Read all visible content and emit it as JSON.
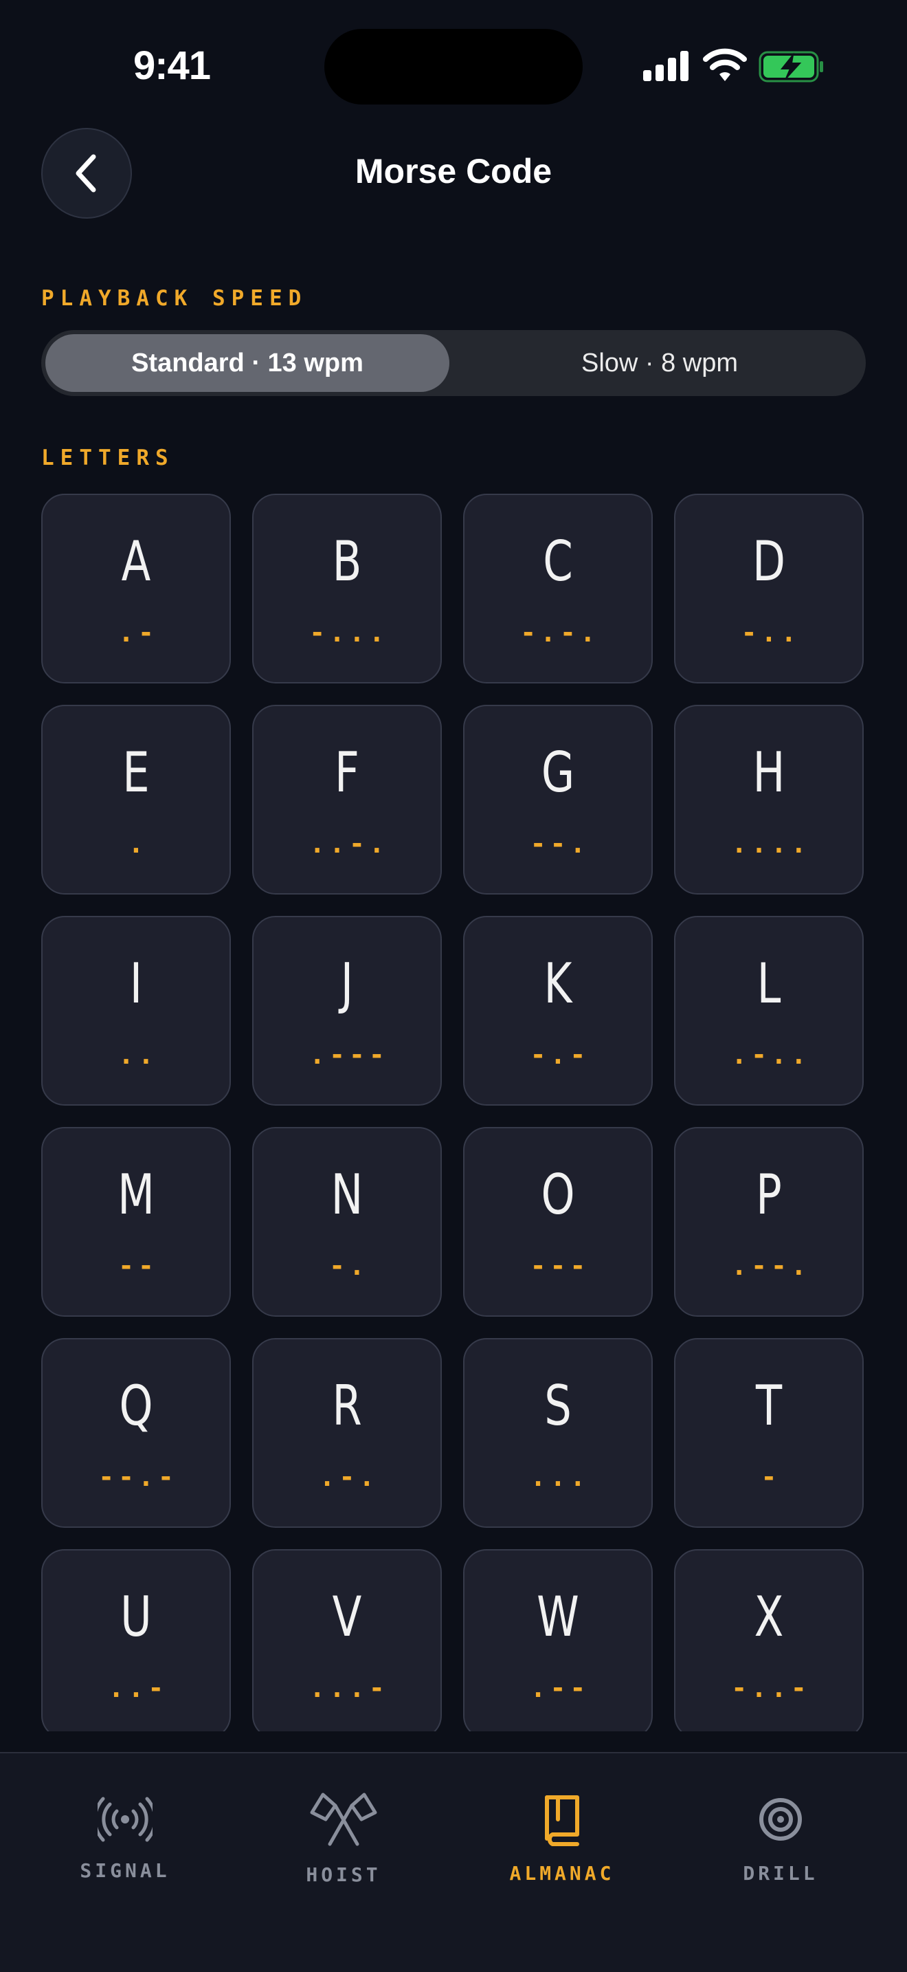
{
  "status_bar": {
    "time": "9:41"
  },
  "header": {
    "title": "Morse Code"
  },
  "speed": {
    "label": "PLAYBACK SPEED",
    "options": [
      "Standard · 13 wpm",
      "Slow · 8 wpm"
    ],
    "selected": "Standard · 13 wpm"
  },
  "letters_label": "LETTERS",
  "letters": [
    {
      "char": "A",
      "code": ".-"
    },
    {
      "char": "B",
      "code": "-..."
    },
    {
      "char": "C",
      "code": "-.-."
    },
    {
      "char": "D",
      "code": "-.."
    },
    {
      "char": "E",
      "code": "."
    },
    {
      "char": "F",
      "code": "..-."
    },
    {
      "char": "G",
      "code": "--."
    },
    {
      "char": "H",
      "code": "...."
    },
    {
      "char": "I",
      "code": ".."
    },
    {
      "char": "J",
      "code": ".---"
    },
    {
      "char": "K",
      "code": "-.-"
    },
    {
      "char": "L",
      "code": ".-.."
    },
    {
      "char": "M",
      "code": "--"
    },
    {
      "char": "N",
      "code": "-."
    },
    {
      "char": "O",
      "code": "---"
    },
    {
      "char": "P",
      "code": ".--."
    },
    {
      "char": "Q",
      "code": "--.-"
    },
    {
      "char": "R",
      "code": ".-."
    },
    {
      "char": "S",
      "code": "..."
    },
    {
      "char": "T",
      "code": "-"
    },
    {
      "char": "U",
      "code": "..-"
    },
    {
      "char": "V",
      "code": "...-"
    },
    {
      "char": "W",
      "code": ".--"
    },
    {
      "char": "X",
      "code": "-..-"
    }
  ],
  "tabs": [
    {
      "label": "SIGNAL",
      "icon": "broadcast-icon",
      "active": false
    },
    {
      "label": "HOIST",
      "icon": "crossed-flags-icon",
      "active": false
    },
    {
      "label": "ALMANAC",
      "icon": "book-icon",
      "active": true
    },
    {
      "label": "DRILL",
      "icon": "target-icon",
      "active": false
    }
  ],
  "colors": {
    "accent": "#f0a92a",
    "background": "#0c0f18",
    "card": "#1e202d",
    "battery": "#34c759"
  }
}
